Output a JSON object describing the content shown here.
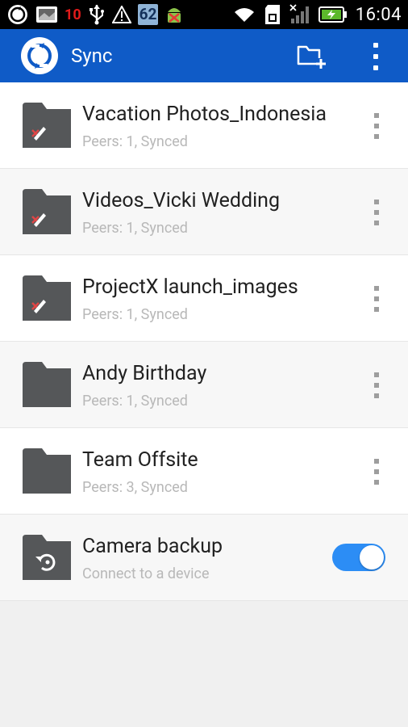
{
  "status_bar": {
    "notif_count": "10",
    "battery_level": "62",
    "time": "16:04"
  },
  "app_bar": {
    "title": "Sync"
  },
  "folders": [
    {
      "name": "Vacation Photos_Indonesia",
      "status": "Peers: 1, Synced",
      "readonly": true
    },
    {
      "name": "Videos_Vicki Wedding",
      "status": "Peers: 1, Synced",
      "readonly": true
    },
    {
      "name": "ProjectX launch_images",
      "status": "Peers: 1, Synced",
      "readonly": true
    },
    {
      "name": "Andy Birthday",
      "status": "Peers: 1, Synced",
      "readonly": false
    },
    {
      "name": "Team Offsite",
      "status": "Peers: 3, Synced",
      "readonly": false
    }
  ],
  "camera_backup": {
    "title": "Camera backup",
    "subtitle": "Connect to a device",
    "enabled": true
  },
  "colors": {
    "app_bar": "#0f5bc7",
    "folder_icon": "#555759",
    "toggle_on": "#2c8df5",
    "readonly_mark": "#e04646"
  }
}
